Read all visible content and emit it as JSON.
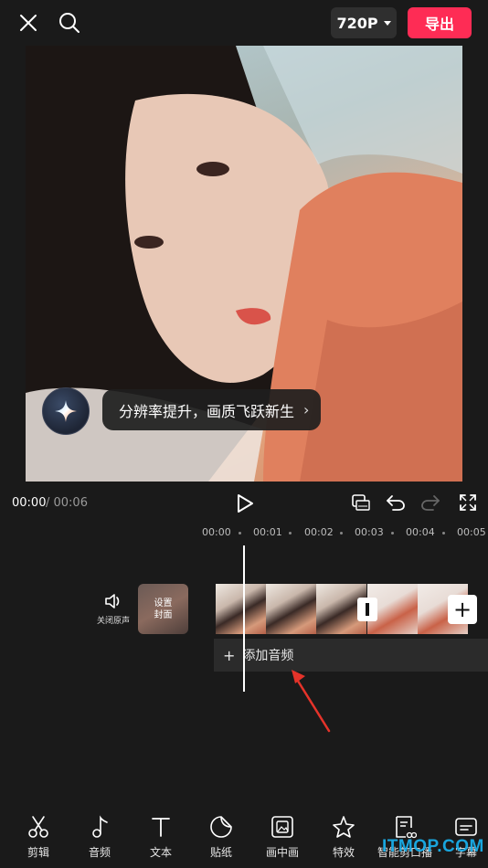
{
  "header": {
    "resolution": "720P",
    "export_label": "导出"
  },
  "preview": {
    "tip_text": "分辨率提升，画质飞跃新生"
  },
  "playback": {
    "current_time": "00:00",
    "total_time": "/ 00:06"
  },
  "timeline": {
    "ruler": [
      "00:00",
      "00:01",
      "00:02",
      "00:03",
      "00:04",
      "00:05"
    ],
    "mute_label": "关闭原声",
    "cover_label": "设置封面",
    "add_audio_label": "添加音频"
  },
  "toolbar": {
    "items": [
      "剪辑",
      "音频",
      "文本",
      "贴纸",
      "画中画",
      "特效",
      "智能剪口播",
      "字幕"
    ]
  },
  "watermark": {
    "text": "ITMOP.COM"
  },
  "colors": {
    "accent": "#fe2c55",
    "arrow": "#e5332a",
    "background": "#1a1a1a"
  }
}
